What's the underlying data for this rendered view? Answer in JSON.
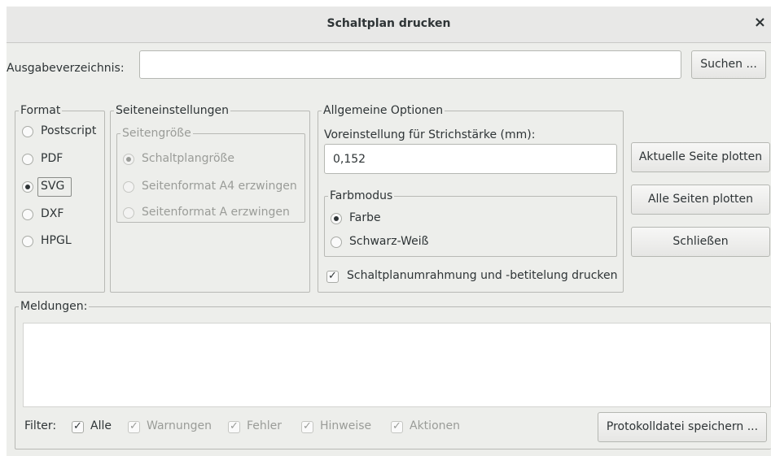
{
  "window": {
    "title": "Schaltplan drucken",
    "close_glyph": "×"
  },
  "output": {
    "label": "Ausgabeverzeichnis:",
    "value": "",
    "browse_label": "Suchen ..."
  },
  "format": {
    "legend": "Format",
    "options": [
      {
        "label": "Postscript",
        "selected": false
      },
      {
        "label": "PDF",
        "selected": false
      },
      {
        "label": "SVG",
        "selected": true
      },
      {
        "label": "DXF",
        "selected": false
      },
      {
        "label": "HPGL",
        "selected": false
      }
    ]
  },
  "page_settings": {
    "legend": "Seiteneinstellungen",
    "size_legend": "Seitengröße",
    "options": [
      {
        "label": "Schaltplangröße",
        "selected": true
      },
      {
        "label": "Seitenformat A4 erzwingen",
        "selected": false
      },
      {
        "label": "Seitenformat A erzwingen",
        "selected": false
      }
    ]
  },
  "general": {
    "legend": "Allgemeine Optionen",
    "line_width_label": "Voreinstellung für Strichstärke (mm):",
    "line_width_value": "0,152",
    "color_mode": {
      "legend": "Farbmodus",
      "options": [
        {
          "label": "Farbe",
          "selected": true
        },
        {
          "label": "Schwarz-Weiß",
          "selected": false
        }
      ]
    },
    "frame_checkbox": {
      "label": "Schaltplanumrahmung und -betitelung drucken",
      "checked": true
    }
  },
  "actions": {
    "plot_current": "Aktuelle Seite plotten",
    "plot_all": "Alle Seiten plotten",
    "close": "Schließen"
  },
  "messages": {
    "legend": "Meldungen:",
    "filter_label": "Filter:",
    "filters": [
      {
        "label": "Alle",
        "checked": true,
        "enabled": true
      },
      {
        "label": "Warnungen",
        "checked": true,
        "enabled": false
      },
      {
        "label": "Fehler",
        "checked": true,
        "enabled": false
      },
      {
        "label": "Hinweise",
        "checked": true,
        "enabled": false
      },
      {
        "label": "Aktionen",
        "checked": true,
        "enabled": false
      }
    ],
    "save_log": "Protokolldatei speichern ..."
  },
  "colors": {
    "window_bg": "#edeeeb",
    "titlebar_bg": "#e8e8e7",
    "text": "#2e3436",
    "disabled_text": "#9a9c98"
  },
  "icons": {
    "check": "check-mark-icon",
    "close": "close-icon"
  }
}
